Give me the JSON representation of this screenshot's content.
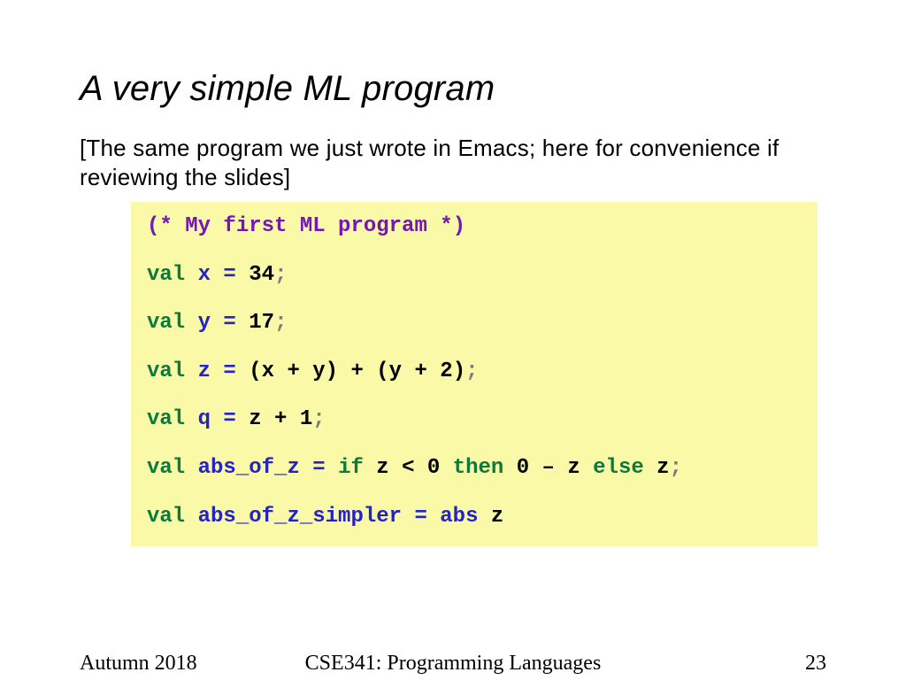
{
  "title": "A very simple ML program",
  "subtitle": "[The same program we just wrote in Emacs; here for convenience if reviewing the slides]",
  "code": {
    "comment": "(* My first ML program *)",
    "l1_kw": "val",
    "l1_id": "x",
    "l1_eq": " = ",
    "l1_val": "34",
    "l1_semi": ";",
    "l2_kw": "val",
    "l2_id": "y",
    "l2_eq": " = ",
    "l2_val": "17",
    "l2_semi": ";",
    "l3_kw": "val",
    "l3_id": "z",
    "l3_eq": " = ",
    "l3_val": "(x + y) + (y + 2)",
    "l3_semi": ";",
    "l4_kw": "val",
    "l4_id": "q",
    "l4_eq": " = ",
    "l4_val": "z + 1",
    "l4_semi": ";",
    "l5_kw": "val",
    "l5_id": "abs_of_z",
    "l5_eq": " = ",
    "l5_if": "if",
    "l5_cond": " z < 0 ",
    "l5_then": "then",
    "l5_then_e": " 0 – z ",
    "l5_else": "else",
    "l5_else_e": " z",
    "l5_semi": ";",
    "l6_kw": "val",
    "l6_id": "abs_of_z_simpler",
    "l6_eq": " = ",
    "l6_fn": "abs",
    "l6_arg": " z"
  },
  "footer": {
    "left": "Autumn 2018",
    "center": "CSE341: Programming Languages",
    "right": "23"
  }
}
